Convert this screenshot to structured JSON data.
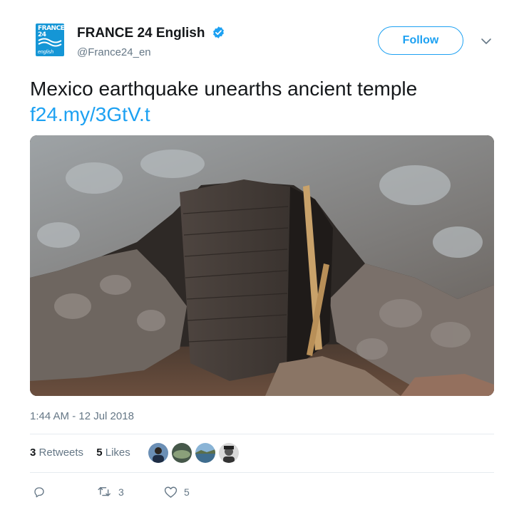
{
  "account": {
    "display_name": "FRANCE 24 English",
    "handle": "@France24_en",
    "avatar_logo_top": "FRANCE",
    "avatar_logo_number": "24",
    "avatar_logo_sub": "english",
    "verified": true
  },
  "follow_label": "Follow",
  "tweet": {
    "text": "Mexico earthquake unearths ancient temple",
    "link": "f24.my/3GtV.t",
    "timestamp": "1:44 AM - 12 Jul 2018"
  },
  "stats": {
    "retweets_count": "3",
    "retweets_label": "Retweets",
    "likes_count": "5",
    "likes_label": "Likes"
  },
  "actions": {
    "reply_count": "",
    "retweet_count": "3",
    "like_count": "5"
  },
  "icons": {
    "verified": "verified-badge-icon",
    "chevron": "chevron-down-icon",
    "reply": "reply-icon",
    "retweet": "retweet-icon",
    "like": "heart-icon"
  },
  "colors": {
    "accent": "#1da1f2",
    "secondary_text": "#657786",
    "primary_text": "#14171a",
    "divider": "#e6ecf0",
    "brand_avatar": "#1596d6"
  }
}
